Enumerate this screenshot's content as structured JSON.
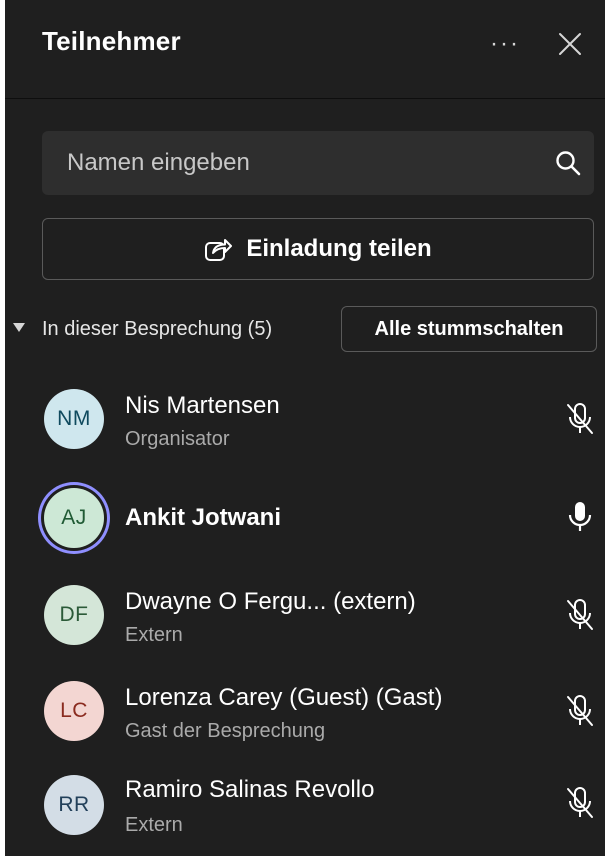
{
  "header": {
    "title": "Teilnehmer",
    "more_label": "···"
  },
  "search": {
    "placeholder": "Namen eingeben"
  },
  "invite": {
    "label": "Einladung teilen"
  },
  "section": {
    "label": "In dieser Besprechung (5)",
    "mute_all_label": "Alle stummschalten"
  },
  "participants": [
    {
      "initials": "NM",
      "name": "Nis Martensen",
      "role": "Organisator",
      "mic": "muted",
      "avatar_bg": "#cfe7ee",
      "avatar_fg": "#0f4a5e"
    },
    {
      "initials": "AJ",
      "name": "Ankit Jotwani",
      "role": "",
      "mic": "on",
      "avatar_bg": "#cde8d6",
      "avatar_fg": "#1f5a34"
    },
    {
      "initials": "DF",
      "name": "Dwayne O Fergu... (extern)",
      "role": "Extern",
      "mic": "muted",
      "avatar_bg": "#d4e6d8",
      "avatar_fg": "#2b5a38"
    },
    {
      "initials": "LC",
      "name": "Lorenza Carey (Guest) (Gast)",
      "role": "Gast der Besprechung",
      "mic": "muted",
      "avatar_bg": "#f3d6d2",
      "avatar_fg": "#8a2b1f"
    },
    {
      "initials": "RR",
      "name": "Ramiro Salinas Revollo",
      "role": "Extern",
      "mic": "muted",
      "avatar_bg": "#d3dde6",
      "avatar_fg": "#22405a"
    }
  ]
}
